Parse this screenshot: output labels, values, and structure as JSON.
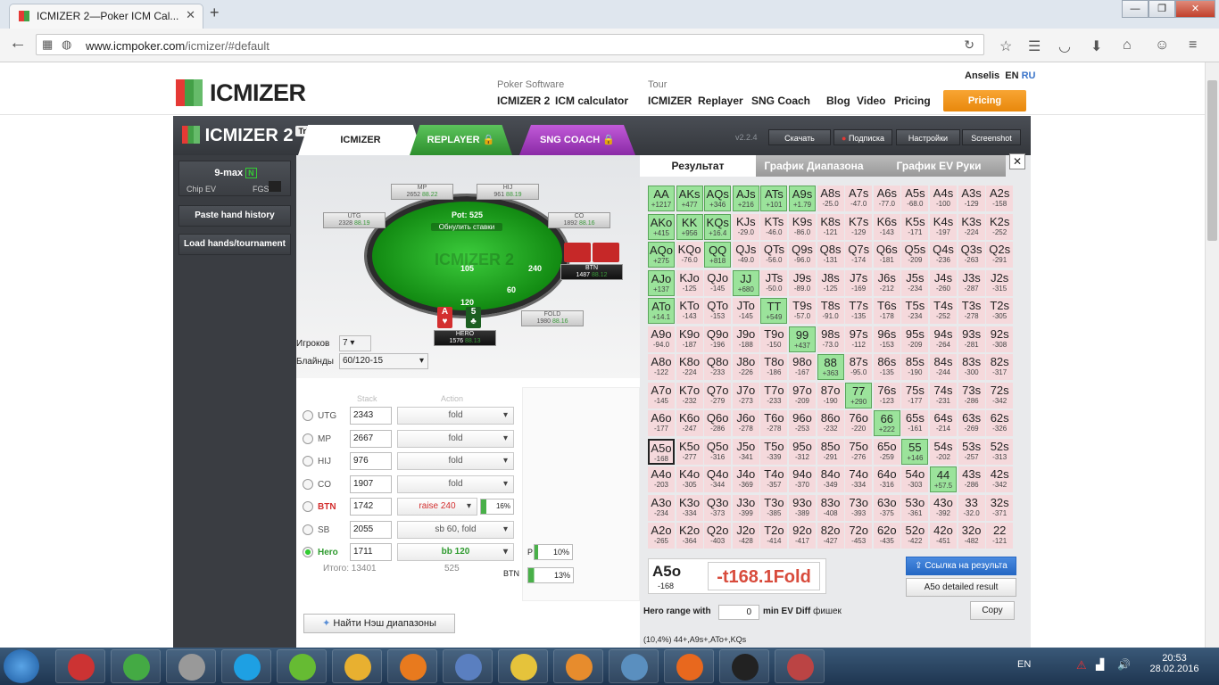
{
  "browser": {
    "tab_title": "ICMIZER 2—Poker ICM Cal...",
    "url_host": "www.icmpoker.com",
    "url_path": "/icmizer/#default"
  },
  "site": {
    "logo": "ICMIZER",
    "user": "Anselis",
    "lang_en": "EN",
    "lang_ru": "RU",
    "nav_software_caption": "Poker Software",
    "nav_tour_caption": "Tour",
    "nav": [
      "ICMIZER 2",
      "ICM calculator",
      "ICMIZER",
      "Replayer",
      "SNG Coach",
      "Blog",
      "Video",
      "Pricing"
    ],
    "pricing_button": "Pricing"
  },
  "app": {
    "logo": "ICMIZER 2",
    "trial": "Trial",
    "version": "v2.2.4",
    "tabs": [
      "ICMIZER",
      "REPLAYER",
      "SNG COACH"
    ],
    "tools": [
      "Скачать",
      "Подписка",
      "Настройки",
      "Screenshot"
    ],
    "sidebar": {
      "format": "9-max",
      "chip_ev": "Chip EV",
      "fgs": "FGS",
      "paste": "Paste hand history",
      "load": "Load hands/tournament"
    },
    "table": {
      "pot": "Pot: 525",
      "reset": "Обнулить ставки",
      "seats": [
        {
          "n": "MP",
          "s": "2652",
          "v": "88.22"
        },
        {
          "n": "HIJ",
          "s": "961",
          "v": "88.19"
        },
        {
          "n": "UTG",
          "s": "2328",
          "v": "88.19"
        },
        {
          "n": "CO",
          "s": "1892",
          "v": "88.16"
        },
        {
          "n": "BTN",
          "s": "1487",
          "v": "88.12"
        },
        {
          "n": "FOLD",
          "s": "1980",
          "v": "88.16"
        },
        {
          "n": "HERO",
          "s": "1576",
          "v": "88.13"
        }
      ],
      "bets": [
        "105",
        "240",
        "60",
        "120"
      ]
    },
    "players_label": "Игроков",
    "players": "7",
    "blinds_label": "Блайнды",
    "blinds": "60/120-15",
    "stack_hdr": "Stack",
    "action_hdr": "Action",
    "rows": [
      {
        "p": "UTG",
        "st": "2343",
        "a": "fold"
      },
      {
        "p": "MP",
        "st": "2667",
        "a": "fold"
      },
      {
        "p": "HIJ",
        "st": "976",
        "a": "fold"
      },
      {
        "p": "CO",
        "st": "1907",
        "a": "fold"
      },
      {
        "p": "BTN",
        "st": "1742",
        "a": "raise 240",
        "pct": "16%"
      },
      {
        "p": "SB",
        "st": "2055",
        "a": "sb 60, fold"
      },
      {
        "p": "Hero",
        "st": "1711",
        "a": "bb 120"
      }
    ],
    "total_label": "Итого:",
    "total": "13401",
    "total_pot": "525",
    "p_label": "P",
    "p_pct": "10%",
    "btn_label": "BTN",
    "btn_pct": "13%",
    "nash_btn": "Найти Нэш диапазоны",
    "result_tabs": [
      "Результат",
      "График Диапазона",
      "График EV Руки"
    ],
    "hand": "A5o",
    "hand_sub": "-168",
    "hand_value": "-t168.1Fold",
    "link_btn": "Ссылка на результа",
    "detail_btn": "A5o detailed result",
    "hero_range": "Hero range with",
    "hero_range_val": "0",
    "min_ev": "min EV Diff",
    "fishek": "фишек",
    "copy": "Copy",
    "range_text": "(10,4%) 44+,A9s+,ATo+,KQs"
  },
  "grid": [
    [
      "AA|+1217|g",
      "AKs|+477|g",
      "AQs|+346|g",
      "AJs|+216|g",
      "ATs|+101|g",
      "A9s|+1.79|g",
      "A8s|-25.0",
      "A7s|-47.0",
      "A6s|-77.0",
      "A5s|-68.0",
      "A4s|-100",
      "A3s|-129",
      "A2s|-158"
    ],
    [
      "AKo|+415|g",
      "KK|+956|g",
      "KQs|+16.4|g",
      "KJs|-29.0",
      "KTs|-46.0",
      "K9s|-86.0",
      "K8s|-121",
      "K7s|-129",
      "K6s|-143",
      "K5s|-171",
      "K4s|-197",
      "K3s|-224",
      "K2s|-252"
    ],
    [
      "AQo|+275|g",
      "KQo|-76.0",
      "QQ|+818|g",
      "QJs|-49.0",
      "QTs|-56.0",
      "Q9s|-96.0",
      "Q8s|-131",
      "Q7s|-174",
      "Q6s|-181",
      "Q5s|-209",
      "Q4s|-236",
      "Q3s|-263",
      "Q2s|-291"
    ],
    [
      "AJo|+137|g",
      "KJo|-125",
      "QJo|-145",
      "JJ|+680|g",
      "JTs|-50.0",
      "J9s|-89.0",
      "J8s|-125",
      "J7s|-169",
      "J6s|-212",
      "J5s|-234",
      "J4s|-260",
      "J3s|-287",
      "J2s|-315"
    ],
    [
      "ATo|+14.1|g",
      "KTo|-143",
      "QTo|-153",
      "JTo|-145",
      "TT|+549|g",
      "T9s|-57.0",
      "T8s|-91.0",
      "T7s|-135",
      "T6s|-178",
      "T5s|-234",
      "T4s|-252",
      "T3s|-278",
      "T2s|-305"
    ],
    [
      "A9o|-94.0",
      "K9o|-187",
      "Q9o|-196",
      "J9o|-188",
      "T9o|-150",
      "99|+437|g",
      "98s|-73.0",
      "97s|-112",
      "96s|-153",
      "95s|-209",
      "94s|-264",
      "93s|-281",
      "92s|-308"
    ],
    [
      "A8o|-122",
      "K8o|-224",
      "Q8o|-233",
      "J8o|-226",
      "T8o|-186",
      "98o|-167",
      "88|+363|g",
      "87s|-95.0",
      "86s|-135",
      "85s|-190",
      "84s|-244",
      "83s|-300",
      "82s|-317"
    ],
    [
      "A7o|-145",
      "K7o|-232",
      "Q7o|-279",
      "J7o|-273",
      "T7o|-233",
      "97o|-209",
      "87o|-190",
      "77|+290|g",
      "76s|-123",
      "75s|-177",
      "74s|-231",
      "73s|-286",
      "72s|-342"
    ],
    [
      "A6o|-177",
      "K6o|-247",
      "Q6o|-286",
      "J6o|-278",
      "T6o|-278",
      "96o|-253",
      "86o|-232",
      "76o|-220",
      "66|+222|g",
      "65s|-161",
      "64s|-214",
      "63s|-269",
      "62s|-326"
    ],
    [
      "A5o|-168|sel",
      "K5o|-277",
      "Q5o|-316",
      "J5o|-341",
      "T5o|-339",
      "95o|-312",
      "85o|-291",
      "75o|-276",
      "65o|-259",
      "55|+146|g",
      "54s|-202",
      "53s|-257",
      "52s|-313"
    ],
    [
      "A4o|-203",
      "K4o|-305",
      "Q4o|-344",
      "J4o|-369",
      "T4o|-357",
      "94o|-370",
      "84o|-349",
      "74o|-334",
      "64o|-316",
      "54o|-303",
      "44|+57.5|g",
      "43s|-286",
      "42s|-342"
    ],
    [
      "A3o|-234",
      "K3o|-334",
      "Q3o|-373",
      "J3o|-399",
      "T3o|-385",
      "93o|-389",
      "83o|-408",
      "73o|-393",
      "63o|-375",
      "53o|-361",
      "43o|-392",
      "33|-32.0",
      "32s|-371"
    ],
    [
      "A2o|-265",
      "K2o|-364",
      "Q2o|-403",
      "J2o|-428",
      "T2o|-414",
      "92o|-417",
      "82o|-427",
      "72o|-453",
      "62o|-435",
      "52o|-422",
      "42o|-451",
      "32o|-482",
      "22|-121"
    ]
  ],
  "taskbar": {
    "lang": "EN",
    "time": "20:53",
    "date": "28.02.2016"
  }
}
